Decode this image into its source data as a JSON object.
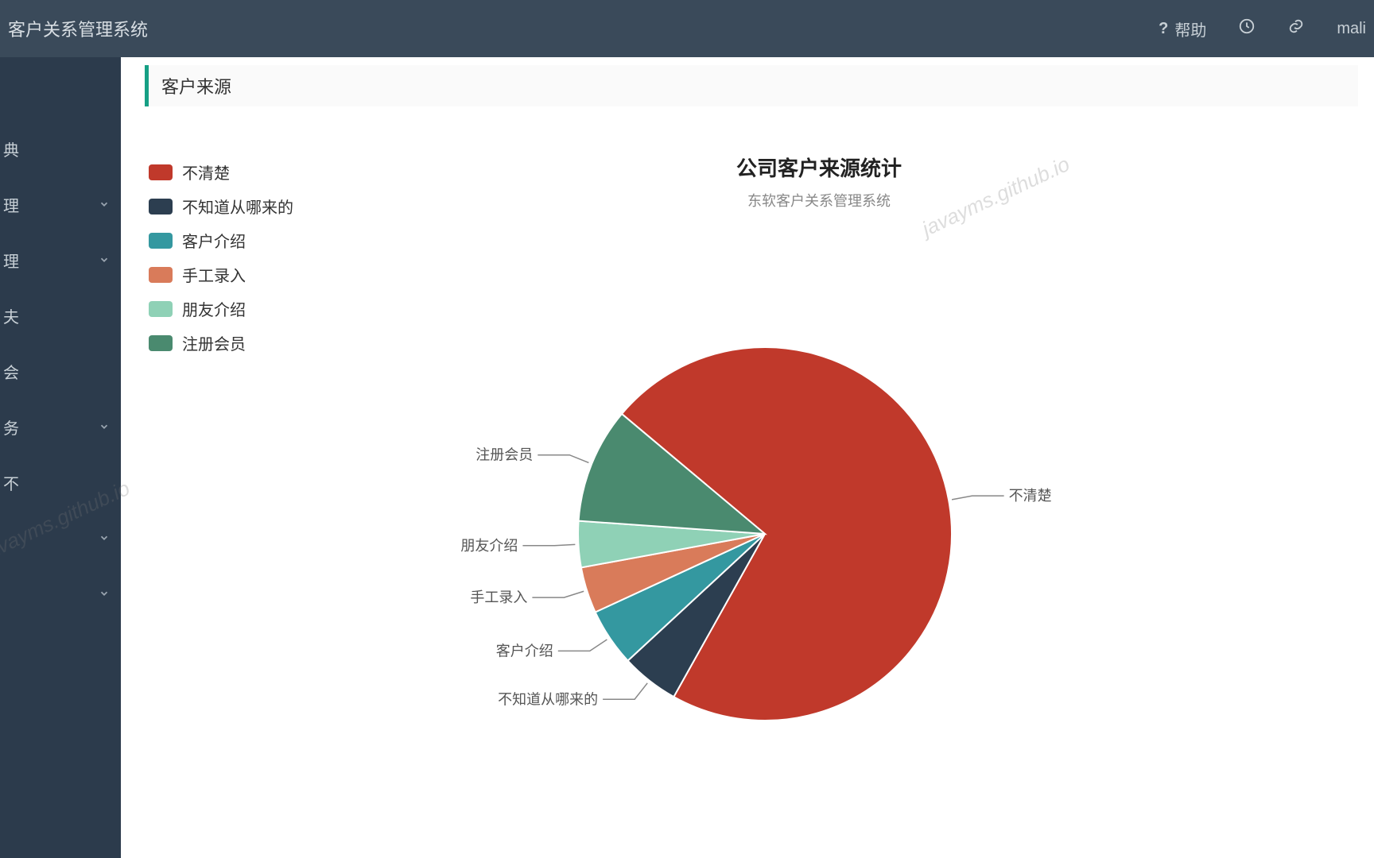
{
  "header": {
    "title": "客户关系管理系统",
    "help_label": "帮助",
    "user_label": "mali"
  },
  "sidebar": {
    "items": [
      {
        "label": "典",
        "expandable": false
      },
      {
        "label": "理",
        "expandable": true
      },
      {
        "label": "理",
        "expandable": true
      },
      {
        "label": "夫",
        "expandable": false
      },
      {
        "label": "会",
        "expandable": false
      },
      {
        "label": "务",
        "expandable": true
      },
      {
        "label": "不",
        "expandable": false
      },
      {
        "label": "",
        "expandable": true
      },
      {
        "label": "",
        "expandable": true
      }
    ]
  },
  "panel": {
    "title": "客户来源"
  },
  "chart_data": {
    "type": "pie",
    "title": "公司客户来源统计",
    "subtitle": "东软客户关系管理系统",
    "series": [
      {
        "name": "不清楚",
        "value": 72,
        "color": "#c0392b"
      },
      {
        "name": "不知道从哪来的",
        "value": 5,
        "color": "#2c3e50"
      },
      {
        "name": "客户介绍",
        "value": 5,
        "color": "#3498a0"
      },
      {
        "name": "手工录入",
        "value": 4,
        "color": "#d97b5a"
      },
      {
        "name": "朋友介绍",
        "value": 4,
        "color": "#8fd1b6"
      },
      {
        "name": "注册会员",
        "value": 10,
        "color": "#4a8a6f"
      }
    ]
  },
  "watermarks": [
    "javayms.github.io",
    "javayms.github.io"
  ]
}
